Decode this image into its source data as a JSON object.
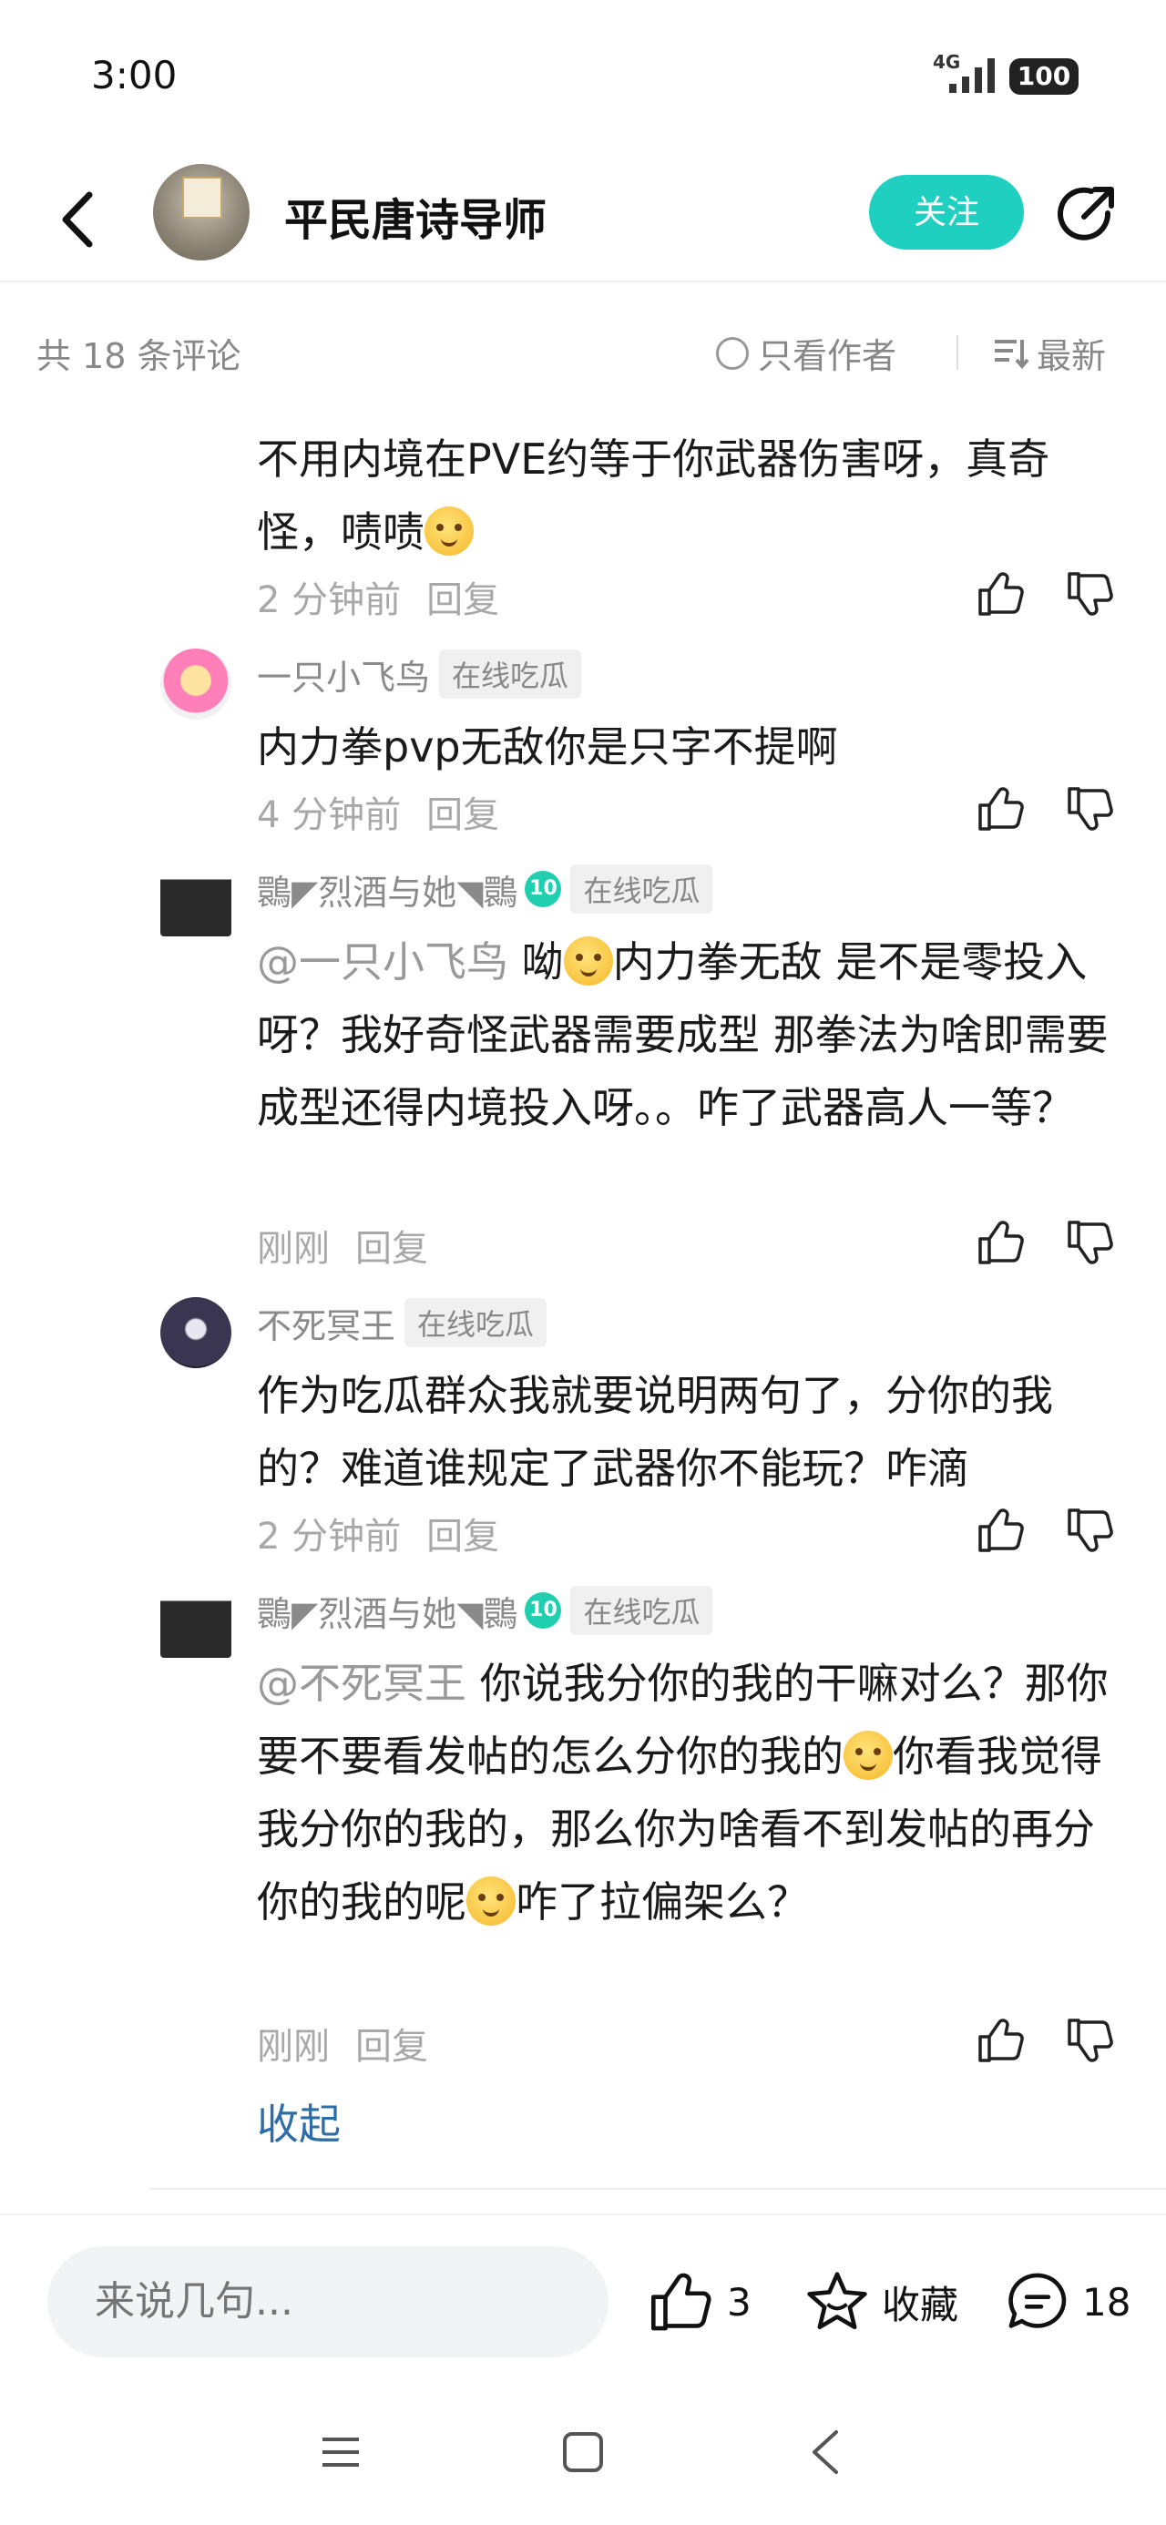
{
  "status_bar": {
    "time": "3:00",
    "network": "4G",
    "battery": "100"
  },
  "header": {
    "author_name": "平民唐诗导师",
    "follow_label": "关注"
  },
  "summary": {
    "count_text": "共 18 条评论",
    "only_author_label": "只看作者",
    "sort_label": "最新"
  },
  "comments": [
    {
      "text_before": "不用内境在PVE约等于你武器伤害呀，真奇怪，啧啧",
      "emoji": "smile-emoji",
      "time": "2 分钟前",
      "reply_label": "回复"
    },
    {
      "name": "一只小飞鸟",
      "tag": "在线吃瓜",
      "text": "内力拳pvp无敌你是只字不提啊",
      "time": "4 分钟前",
      "reply_label": "回复"
    },
    {
      "name": "䴉◤烈酒与她◥䴉",
      "level": "10",
      "tag": "在线吃瓜",
      "mention": "@一只小飞鸟",
      "text_a": "  呦",
      "text_b": "内力拳无敌  是不是零投入呀？我好奇怪武器需要成型  那拳法为啥即需要成型还得内境投入呀。。咋了武器高人一等？",
      "time": "刚刚",
      "reply_label": "回复"
    },
    {
      "name": "不死冥王",
      "tag": "在线吃瓜",
      "text": "作为吃瓜群众我就要说明两句了，分你的我的？难道谁规定了武器你不能玩？咋滴",
      "time": "2 分钟前",
      "reply_label": "回复"
    },
    {
      "name": "䴉◤烈酒与她◥䴉",
      "level": "10",
      "tag": "在线吃瓜",
      "mention": "@不死冥王",
      "text_a": "  你说我分你的我的干嘛对么？那你要不要看发帖的怎么分你的我的",
      "text_b": "你看我觉得我分你的我的，那么你为啥看不到发帖的再分你的我的呢",
      "text_c": "咋了拉偏架么？",
      "time": "刚刚",
      "reply_label": "回复"
    }
  ],
  "collapse_label": "收起",
  "bottom_bar": {
    "input_placeholder": "来说几句...",
    "like_count": "3",
    "favorite_label": "收藏",
    "comment_count": "18"
  },
  "colors": {
    "accent": "#1fcfc0",
    "link": "#2e6ea6",
    "muted": "#a8a8a8"
  }
}
